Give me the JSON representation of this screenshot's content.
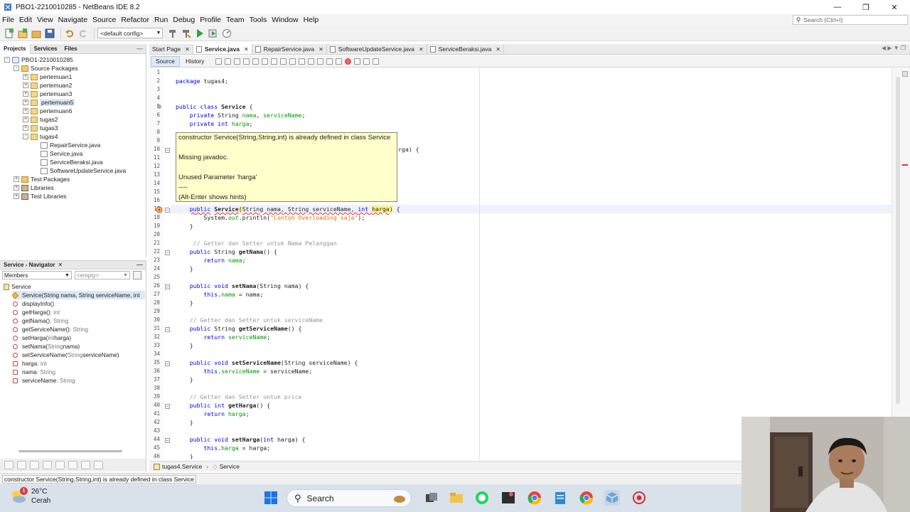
{
  "window": {
    "title": "PBO1-2210010285 - NetBeans IDE 8.2"
  },
  "menu": [
    "File",
    "Edit",
    "View",
    "Navigate",
    "Source",
    "Refactor",
    "Run",
    "Debug",
    "Profile",
    "Team",
    "Tools",
    "Window",
    "Help"
  ],
  "search": {
    "placeholder": "Search (Ctrl+I)"
  },
  "toolbar": {
    "config": "<default config>"
  },
  "projects_pane": {
    "tabs": [
      "Projects",
      "Services",
      "Files"
    ],
    "tree": [
      {
        "label": "PBO1-2210010285",
        "level": 0,
        "icon": "project",
        "toggle": "-"
      },
      {
        "label": "Source Packages",
        "level": 1,
        "icon": "folder",
        "toggle": "-"
      },
      {
        "label": "pertemuan1",
        "level": 2,
        "icon": "package",
        "toggle": "+"
      },
      {
        "label": "pertemuan2",
        "level": 2,
        "icon": "package",
        "toggle": "+"
      },
      {
        "label": "pertemuan3",
        "level": 2,
        "icon": "package",
        "toggle": "+"
      },
      {
        "label": "pertemuan5",
        "level": 2,
        "icon": "package",
        "toggle": "+",
        "highlighted": true
      },
      {
        "label": "pertemuan6",
        "level": 2,
        "icon": "package",
        "toggle": "+"
      },
      {
        "label": "tugas2",
        "level": 2,
        "icon": "package",
        "toggle": "+"
      },
      {
        "label": "tugas3",
        "level": 2,
        "icon": "package",
        "toggle": "+"
      },
      {
        "label": "tugas4",
        "level": 2,
        "icon": "package",
        "toggle": "-"
      },
      {
        "label": "RepairService.java",
        "level": 3,
        "icon": "file"
      },
      {
        "label": "Service.java",
        "level": 3,
        "icon": "file"
      },
      {
        "label": "ServiceBeraksi.java",
        "level": 3,
        "icon": "file"
      },
      {
        "label": "SoftwareUpdateService.java",
        "level": 3,
        "icon": "file"
      },
      {
        "label": "Test Packages",
        "level": 1,
        "icon": "folder",
        "toggle": "+"
      },
      {
        "label": "Libraries",
        "level": 1,
        "icon": "lib",
        "toggle": "+"
      },
      {
        "label": "Test Libraries",
        "level": 1,
        "icon": "lib",
        "toggle": "+"
      }
    ]
  },
  "navigator": {
    "title": "Service - Navigator",
    "filter": "Members",
    "empty": "<empty>",
    "root": "Service",
    "members": [
      {
        "name": "Service(String nama, String serviceName, int",
        "type": "",
        "kind": "ctor",
        "selected": true
      },
      {
        "name": "displayInfo()",
        "type": "",
        "kind": "method"
      },
      {
        "name": "getHarga()",
        "type": " : int",
        "kind": "method"
      },
      {
        "name": "getNama()",
        "type": " : String",
        "kind": "method"
      },
      {
        "name": "getServiceName()",
        "type": " : String",
        "kind": "method"
      },
      {
        "name": "setHarga(",
        "param_type": "int",
        "param": " harga)",
        "kind": "method_param"
      },
      {
        "name": "setNama(",
        "param_type": "String",
        "param": " nama)",
        "kind": "method_param"
      },
      {
        "name": "setServiceName(",
        "param_type": "String",
        "param": " serviceName)",
        "kind": "method_param"
      },
      {
        "name": "harga",
        "type": " : int",
        "kind": "field"
      },
      {
        "name": "nama",
        "type": " : String",
        "kind": "field"
      },
      {
        "name": "serviceName",
        "type": " : String",
        "kind": "field"
      }
    ]
  },
  "editor": {
    "tabs": [
      {
        "label": "Start Page",
        "active": false
      },
      {
        "label": "Service.java",
        "active": true
      },
      {
        "label": "RepairService.java",
        "active": false
      },
      {
        "label": "SoftwareUpdateService.java",
        "active": false
      },
      {
        "label": "ServiceBeraksi.java",
        "active": false
      }
    ],
    "source_tab": "Source",
    "history_tab": "History",
    "line_numbers": [
      "1",
      "2",
      "3",
      "4",
      "5",
      "6",
      "7",
      "8",
      "9",
      "10",
      "11",
      "12",
      "13",
      "14",
      "15",
      "16",
      "17",
      "18",
      "19",
      "20",
      "21",
      "22",
      "23",
      "24",
      "25",
      "26",
      "27",
      "28",
      "29",
      "30",
      "31",
      "32",
      "33",
      "34",
      "35",
      "36",
      "37",
      "38",
      "39",
      "40",
      "41",
      "42",
      "43",
      "44",
      "45",
      "46"
    ],
    "tooltip": {
      "line1": "constructor Service(String,String,int) is already defined in class Service",
      "line2": "Missing javadoc.",
      "line3": "Unused Parameter 'harga'",
      "line4": "----",
      "line5": "(Alt-Enter shows hints)"
    },
    "code_line10_tail": "rga) {",
    "breadcrumb": [
      "tugas4.Service",
      "Service"
    ]
  },
  "status": {
    "message": "constructor Service(String,String,int) is already defined in class Service"
  },
  "taskbar": {
    "weather_temp": "26°C",
    "weather_desc": "Cerah",
    "badge": "1",
    "search_label": "Search"
  }
}
